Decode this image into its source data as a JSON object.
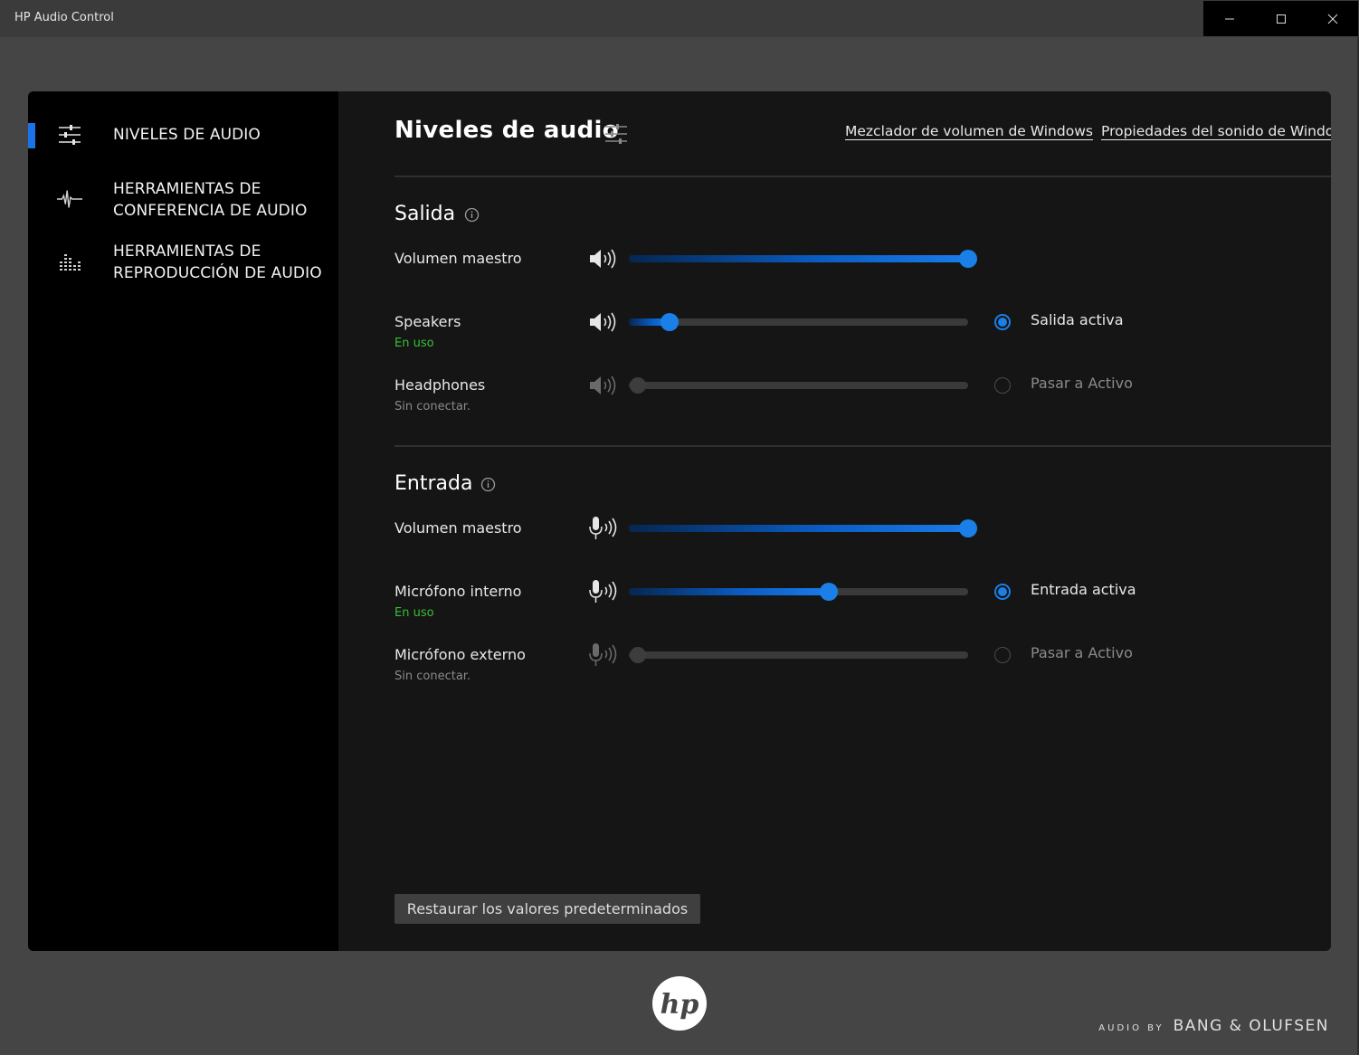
{
  "window": {
    "title": "HP Audio Control"
  },
  "sidebar": {
    "items": [
      {
        "label": "NIVELES DE AUDIO",
        "icon": "sliders-icon",
        "active": true
      },
      {
        "label": "HERRAMIENTAS DE\nCONFERENCIA DE AUDIO",
        "icon": "waveform-icon",
        "active": false
      },
      {
        "label": "HERRAMIENTAS DE\nREPRODUCCIÓN DE AUDIO",
        "icon": "equalizer-icon",
        "active": false
      }
    ]
  },
  "main": {
    "title": "Niveles de audio",
    "links": {
      "mixer": "Mezclador de volumen de Windows",
      "sound_properties": "Propiedades del sonido de Windows"
    }
  },
  "output": {
    "title": "Salida",
    "master": {
      "label": "Volumen maestro",
      "level": 1.0
    },
    "devices": [
      {
        "name": "Speakers",
        "status": "En uso",
        "level": 0.12,
        "active": true,
        "radio_label": "Salida activa"
      },
      {
        "name": "Headphones",
        "status": "Sin conectar.",
        "level": 0.0,
        "active": false,
        "radio_label": "Pasar a Activo"
      }
    ]
  },
  "input": {
    "title": "Entrada",
    "master": {
      "label": "Volumen maestro",
      "level": 1.0
    },
    "devices": [
      {
        "name": "Micrófono interno",
        "status": "En uso",
        "level": 0.59,
        "active": true,
        "radio_label": "Entrada activa"
      },
      {
        "name": "Micrófono externo",
        "status": "Sin conectar.",
        "level": 0.0,
        "active": false,
        "radio_label": "Pasar a Activo"
      }
    ]
  },
  "footer": {
    "reset_label": "Restaurar los valores predeterminados",
    "logo_text": "hp",
    "audio_by": "AUDIO BY",
    "brand": "BANG & OLUFSEN"
  },
  "colors": {
    "accent": "#1a7fe6",
    "in_use": "#36c036",
    "disconnected": "#8a8a8a",
    "sidebar_bg": "#000000",
    "panel_bg": "#151515"
  }
}
